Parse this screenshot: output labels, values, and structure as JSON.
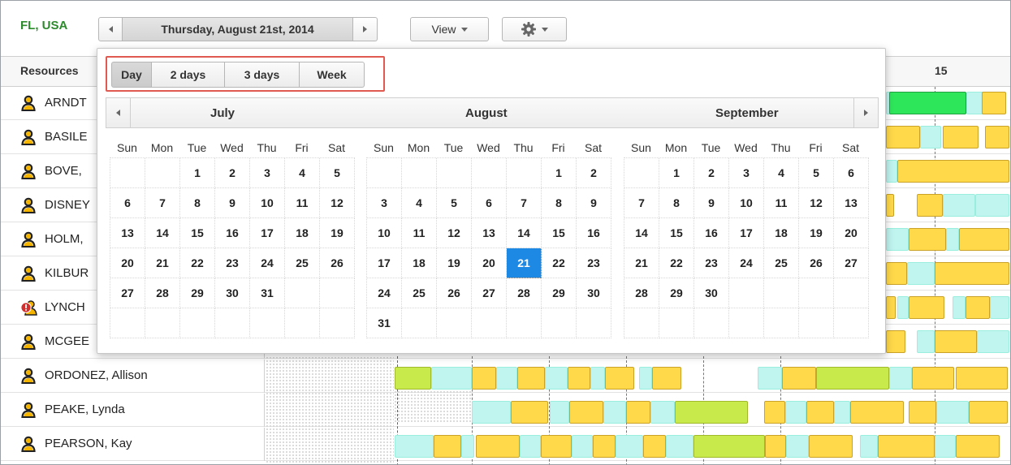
{
  "location": "FL, USA",
  "date_nav": {
    "current_date": "Thursday, August 21st, 2014"
  },
  "view_button": {
    "label": "View"
  },
  "header": {
    "resources_label": "Resources",
    "timeline_label": "15"
  },
  "resources": [
    {
      "name": "ARNDT",
      "icon": "person-icon"
    },
    {
      "name": "BASILE",
      "icon": "person-icon"
    },
    {
      "name": "BOVE,",
      "icon": "person-icon"
    },
    {
      "name": "DISNEY",
      "icon": "person-icon"
    },
    {
      "name": "HOLM,",
      "icon": "person-icon"
    },
    {
      "name": "KILBUR",
      "icon": "person-icon"
    },
    {
      "name": "LYNCH",
      "icon": "alert-person-icon"
    },
    {
      "name": "MCGEE",
      "icon": "person-icon"
    },
    {
      "name": "ORDONEZ, Allison",
      "icon": "person-icon"
    },
    {
      "name": "PEAKE, Lynda",
      "icon": "person-icon"
    },
    {
      "name": "PEARSON, Kay",
      "icon": "person-icon"
    }
  ],
  "popup": {
    "range_buttons": [
      "Day",
      "2 days",
      "3 days",
      "Week"
    ],
    "active_range": "Day",
    "months": [
      {
        "name": "July",
        "weekdays": [
          "Sun",
          "Mon",
          "Tue",
          "Wed",
          "Thu",
          "Fri",
          "Sat"
        ],
        "weeks": [
          [
            "",
            "",
            "1",
            "2",
            "3",
            "4",
            "5"
          ],
          [
            "6",
            "7",
            "8",
            "9",
            "10",
            "11",
            "12"
          ],
          [
            "13",
            "14",
            "15",
            "16",
            "17",
            "18",
            "19"
          ],
          [
            "20",
            "21",
            "22",
            "23",
            "24",
            "25",
            "26"
          ],
          [
            "27",
            "28",
            "29",
            "30",
            "31",
            "",
            ""
          ],
          [
            "",
            "",
            "",
            "",
            "",
            "",
            ""
          ]
        ]
      },
      {
        "name": "August",
        "weekdays": [
          "Sun",
          "Mon",
          "Tue",
          "Wed",
          "Thu",
          "Fri",
          "Sat"
        ],
        "weeks": [
          [
            "",
            "",
            "",
            "",
            "",
            "1",
            "2"
          ],
          [
            "3",
            "4",
            "5",
            "6",
            "7",
            "8",
            "9"
          ],
          [
            "10",
            "11",
            "12",
            "13",
            "14",
            "15",
            "16"
          ],
          [
            "17",
            "18",
            "19",
            "20",
            "21",
            "22",
            "23"
          ],
          [
            "24",
            "25",
            "26",
            "27",
            "28",
            "29",
            "30"
          ],
          [
            "31",
            "",
            "",
            "",
            "",
            "",
            ""
          ]
        ],
        "selected": "21"
      },
      {
        "name": "September",
        "weekdays": [
          "Sun",
          "Mon",
          "Tue",
          "Wed",
          "Thu",
          "Fri",
          "Sat"
        ],
        "weeks": [
          [
            "",
            "1",
            "2",
            "3",
            "4",
            "5",
            "6"
          ],
          [
            "7",
            "8",
            "9",
            "10",
            "11",
            "12",
            "13"
          ],
          [
            "14",
            "15",
            "16",
            "17",
            "18",
            "19",
            "20"
          ],
          [
            "21",
            "22",
            "23",
            "24",
            "25",
            "26",
            "27"
          ],
          [
            "28",
            "29",
            "30",
            "",
            "",
            "",
            ""
          ],
          [
            "",
            "",
            "",
            "",
            "",
            "",
            ""
          ]
        ]
      }
    ]
  },
  "colors": {
    "location_green": "#2d8a2d",
    "selected_day": "#1e88e5",
    "highlight_border": "#e05a52",
    "booking_yellow": "#ffd94a",
    "booking_cyan": "#bff4ef",
    "booking_lime": "#c8ea4a",
    "booking_green": "#2ee65a"
  }
}
